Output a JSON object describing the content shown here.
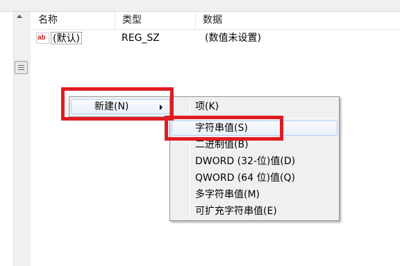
{
  "columns": {
    "name": "名称",
    "type": "类型",
    "data": "数据"
  },
  "row": {
    "icon": "ab",
    "name": "(默认)",
    "type": "REG_SZ",
    "data": "(数值未设置)"
  },
  "context_menu": {
    "items": [
      {
        "label": "新建(N)",
        "has_submenu": true
      }
    ]
  },
  "submenu": {
    "items": [
      {
        "label": "项(K)"
      },
      {
        "label": "字符串值(S)",
        "highlighted": true
      },
      {
        "label": "二进制值(B)"
      },
      {
        "label": "DWORD (32-位)值(D)"
      },
      {
        "label": "QWORD (64 位)值(Q)"
      },
      {
        "label": "多字符串值(M)"
      },
      {
        "label": "可扩充字符串值(E)"
      }
    ]
  },
  "colors": {
    "highlight_box": "#e01b22",
    "menu_background": "#f0f0f0",
    "hover_border": "#aecff7"
  }
}
